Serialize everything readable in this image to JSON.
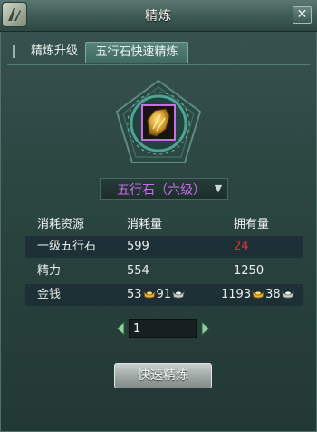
{
  "window": {
    "title": "精炼"
  },
  "tabs": [
    {
      "label": "精炼升级",
      "active": false
    },
    {
      "label": "五行石快速精炼",
      "active": true
    }
  ],
  "item": {
    "icon": "wuxing-stone-icon",
    "rarity_color": "#c66dea"
  },
  "selector": {
    "value": "五行石（六级）"
  },
  "table": {
    "headers": [
      "消耗资源",
      "消耗量",
      "拥有量"
    ],
    "rows": [
      {
        "name": "一级五行石",
        "cost": "599",
        "owned": "24",
        "owned_insufficient": true
      },
      {
        "name": "精力",
        "cost": "554",
        "owned": "1250"
      },
      {
        "name": "金钱",
        "cost_gold": "53",
        "cost_silver": "91",
        "owned_gold": "1193",
        "owned_silver": "38"
      }
    ]
  },
  "quantity": {
    "value": "1"
  },
  "action": {
    "label": "快速精炼"
  },
  "colors": {
    "accent": "#4f8076",
    "insufficient": "#e03030"
  }
}
